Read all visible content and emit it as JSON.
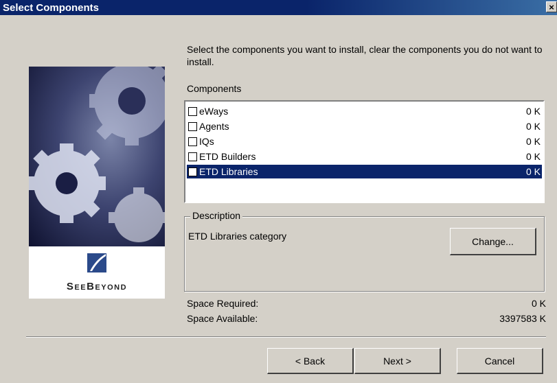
{
  "window": {
    "title": "Select Components",
    "close_label": "×"
  },
  "banner": {
    "brand": "SeeBeyond"
  },
  "intro": {
    "text": "Select the components you want to install, clear the components you do not want to install."
  },
  "components": {
    "label": "Components",
    "items": [
      {
        "name": "eWays",
        "size": "0 K",
        "checked": false,
        "selected": false
      },
      {
        "name": "Agents",
        "size": "0 K",
        "checked": false,
        "selected": false
      },
      {
        "name": "IQs",
        "size": "0 K",
        "checked": false,
        "selected": false
      },
      {
        "name": "ETD Builders",
        "size": "0 K",
        "checked": false,
        "selected": false
      },
      {
        "name": "ETD Libraries",
        "size": "0 K",
        "checked": false,
        "selected": true
      }
    ]
  },
  "description": {
    "title": "Description",
    "text": "ETD Libraries category",
    "change_label": "Change..."
  },
  "space": {
    "required_label": "Space Required:",
    "required_value": "0 K",
    "available_label": "Space Available:",
    "available_value": "3397583 K"
  },
  "buttons": {
    "back": "< Back",
    "next": "Next >",
    "cancel": "Cancel"
  },
  "colors": {
    "title_bar": "#0a246a",
    "selection": "#0a246a",
    "face": "#d4d0c8"
  }
}
